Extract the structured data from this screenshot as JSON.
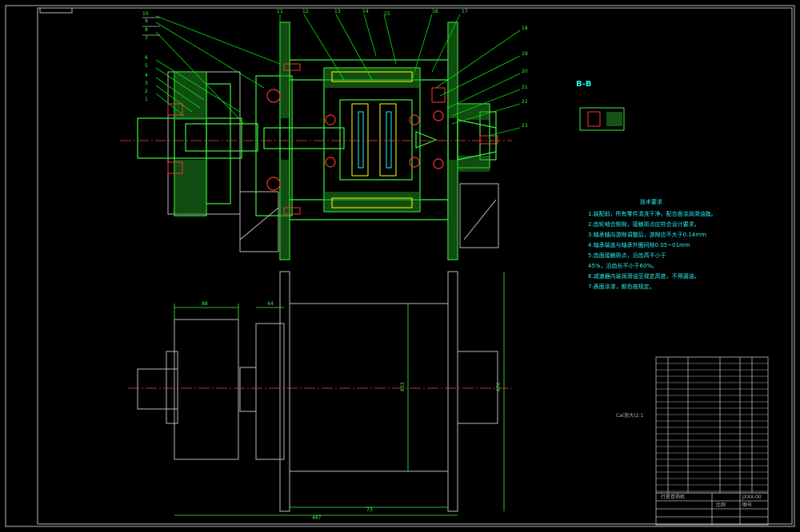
{
  "drawing": {
    "section_label": "B-B",
    "balloons": [
      "10",
      "11",
      "12",
      "13",
      "14",
      "15",
      "16",
      "17",
      "18",
      "19",
      "20",
      "21",
      "22",
      "23",
      "9",
      "8",
      "7",
      "6",
      "5",
      "4",
      "3",
      "2",
      "1"
    ],
    "tech_requirements": {
      "title": "技术要求",
      "lines": [
        "1.装配前，所有零件清洗干净，配合面涂润滑油脂。",
        "2.齿轮啮合侧隙，接触斑点应符合设计要求。",
        "3.轴承轴向游隙调整后，游隙应不大于0.14mm",
        "4.轴承端盖与轴承外圈间隙0.05~01mm",
        "5.齿面接触斑点，沿齿高不小于",
        "45%，沿齿长不小于60%。",
        "6.减速器内装润滑油至规定高度，不得漏油。",
        "7.表面涂漆，颜色按规定。"
      ]
    },
    "dimensions": {
      "flange_width": "88",
      "hub_width": "44",
      "drum_height": "633",
      "overall_height": "676",
      "drum_length": "73",
      "overall_length": "467"
    },
    "view_label": "Ca(放大)2:1",
    "title_block": {
      "drawing_name": "行星卷扬机",
      "drawing_code": "JXXX-00",
      "scale_label": "比例",
      "sheet_label": "图号"
    },
    "colors": {
      "frame": "#b8b8b8",
      "outline": "#3cf23c",
      "annotation": "#29f0f0",
      "leader": "#00e000",
      "section": "#ff3030",
      "highlight": "#ffff00",
      "centerline": "#ff4040"
    }
  }
}
